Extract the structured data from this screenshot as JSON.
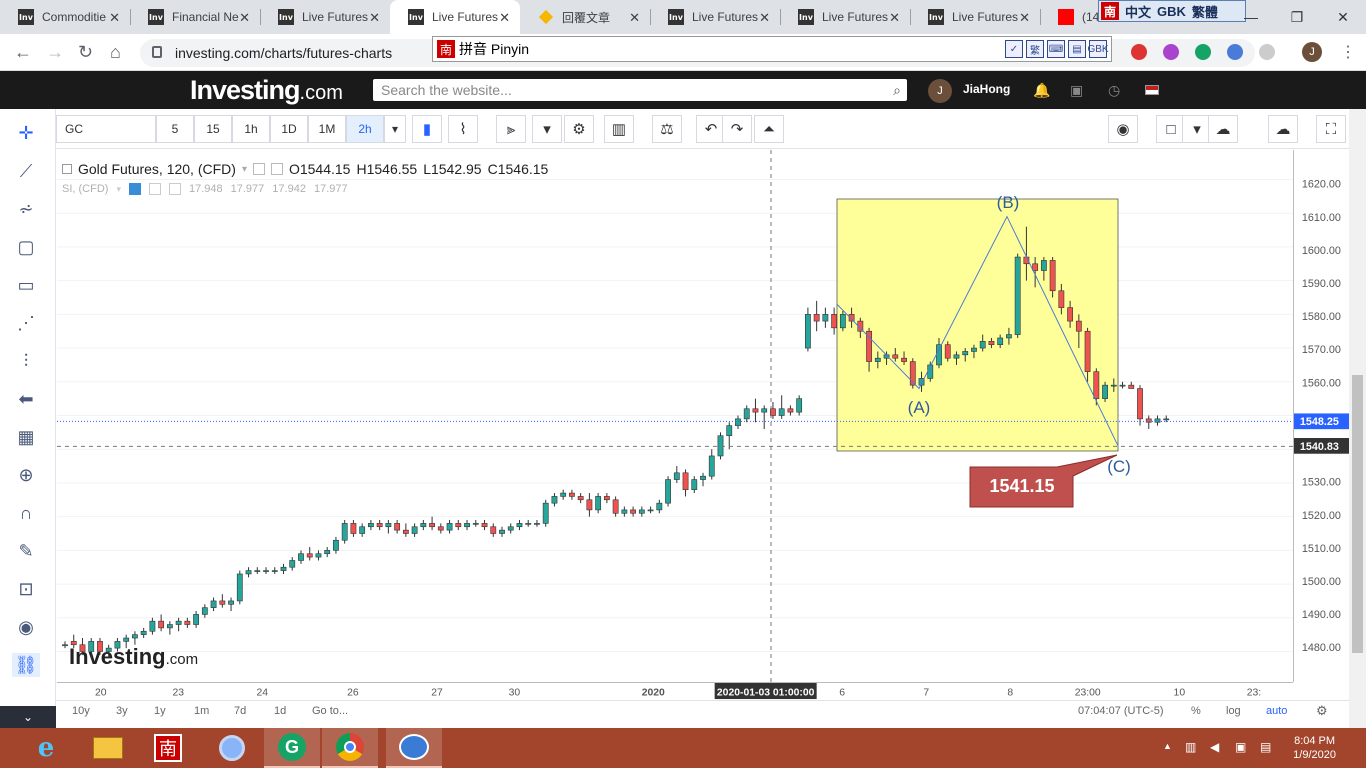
{
  "tabs": [
    {
      "title": "Commoditie",
      "icon": "Inv"
    },
    {
      "title": "Financial Ne",
      "icon": "Inv"
    },
    {
      "title": "Live Futures",
      "icon": "Inv"
    },
    {
      "title": "Live Futures",
      "icon": "Inv"
    },
    {
      "title": "回覆文章",
      "icon": "gem"
    },
    {
      "title": "Live Futures",
      "icon": "Inv"
    },
    {
      "title": "Live Futures",
      "icon": "Inv"
    },
    {
      "title": "Live Futures",
      "icon": "Inv"
    },
    {
      "title": "(14",
      "icon": "yt"
    }
  ],
  "active_tab": 3,
  "ime_bar": {
    "badge": "南",
    "lang": "中文",
    "charset": "GBK",
    "trad": "繁體"
  },
  "ime_popup": {
    "badge": "南",
    "label": "拼音 Pinyin",
    "buttons": [
      "✓",
      "繁",
      "⌨",
      "▤",
      "GBK"
    ]
  },
  "address": {
    "url": "investing.com/charts/futures-charts"
  },
  "profile_initial": "J",
  "site": {
    "logo_main": "Investing",
    "logo_suffix": ".com",
    "search_placeholder": "Search the website...",
    "user_initial": "J",
    "user_name": "JiaHong"
  },
  "toolbar": {
    "symbol": "GC",
    "intervals": [
      "5",
      "15",
      "1h",
      "1D",
      "1M",
      "2h"
    ],
    "active_interval": "2h"
  },
  "legend": {
    "title": "Gold Futures, 120, (CFD)",
    "o": "O1544.15",
    "h": "H1546.55",
    "l": "L1542.95",
    "c": "C1546.15",
    "compare": "SI, (CFD)",
    "compare_values": [
      "17.948",
      "17.977",
      "17.942",
      "17.977"
    ]
  },
  "annotations": {
    "a": "(A)",
    "b": "(B)",
    "c": "(C)",
    "callout": "1541.15",
    "watermark_main": "Investing",
    "watermark_suffix": ".com"
  },
  "price_axis": {
    "ticks": [
      "1620.00",
      "1610.00",
      "1600.00",
      "1590.00",
      "1580.00",
      "1570.00",
      "1560.00",
      "1530.00",
      "1520.00",
      "1510.00",
      "1500.00",
      "1490.00",
      "1480.00"
    ],
    "last_price": "1548.25",
    "crosshair_price": "1540.83"
  },
  "time_axis": {
    "labels": [
      "20",
      "23",
      "24",
      "26",
      "27",
      "30",
      "2020",
      "6",
      "7",
      "8",
      "23:00",
      "10",
      "23:"
    ],
    "crosshair_time": "2020-01-03 01:00:00"
  },
  "bottom": {
    "ranges": [
      "10y",
      "3y",
      "1y",
      "1m",
      "7d",
      "1d",
      "Go to..."
    ],
    "time": "07:04:07 (UTC-5)",
    "pct": "%",
    "log": "log",
    "auto": "auto"
  },
  "taskbar": {
    "time": "8:04 PM",
    "date": "1/9/2020"
  },
  "colors": {
    "up": "#26a69a",
    "down": "#ef5350",
    "accent": "#2962ff",
    "box": "#ffff99",
    "callout": "#c0504d"
  },
  "chart_data": {
    "type": "candlestick",
    "title": "Gold Futures, 120, (CFD)",
    "ylim": [
      1475,
      1625
    ],
    "candles": [
      [
        1482,
        1483,
        1481,
        1482
      ],
      [
        1483,
        1485,
        1481,
        1482
      ],
      [
        1482,
        1484,
        1479,
        1480
      ],
      [
        1480,
        1484,
        1478,
        1483
      ],
      [
        1483,
        1484,
        1479,
        1480
      ],
      [
        1480,
        1482,
        1478,
        1481
      ],
      [
        1481,
        1484,
        1480,
        1483
      ],
      [
        1483,
        1485,
        1481,
        1484
      ],
      [
        1484,
        1486,
        1482,
        1485
      ],
      [
        1485,
        1487,
        1484,
        1486
      ],
      [
        1486,
        1490,
        1485,
        1489
      ],
      [
        1489,
        1491,
        1486,
        1487
      ],
      [
        1487,
        1489,
        1485,
        1488
      ],
      [
        1488,
        1490,
        1486,
        1489
      ],
      [
        1489,
        1490,
        1487,
        1488
      ],
      [
        1488,
        1492,
        1487,
        1491
      ],
      [
        1491,
        1494,
        1490,
        1493
      ],
      [
        1493,
        1496,
        1492,
        1495
      ],
      [
        1495,
        1497,
        1493,
        1494
      ],
      [
        1494,
        1496,
        1492,
        1495
      ],
      [
        1495,
        1504,
        1494,
        1503
      ],
      [
        1503,
        1505,
        1502,
        1504
      ],
      [
        1504,
        1505,
        1503,
        1504
      ],
      [
        1504,
        1505,
        1503,
        1504
      ],
      [
        1504,
        1505,
        1503,
        1504
      ],
      [
        1504,
        1506,
        1503,
        1505
      ],
      [
        1505,
        1508,
        1504,
        1507
      ],
      [
        1507,
        1510,
        1506,
        1509
      ],
      [
        1509,
        1511,
        1507,
        1508
      ],
      [
        1508,
        1510,
        1507,
        1509
      ],
      [
        1509,
        1511,
        1508,
        1510
      ],
      [
        1510,
        1514,
        1509,
        1513
      ],
      [
        1513,
        1519,
        1512,
        1518
      ],
      [
        1518,
        1519,
        1514,
        1515
      ],
      [
        1515,
        1518,
        1514,
        1517
      ],
      [
        1517,
        1519,
        1516,
        1518
      ],
      [
        1518,
        1519,
        1516,
        1517
      ],
      [
        1517,
        1519,
        1515,
        1518
      ],
      [
        1518,
        1519,
        1515,
        1516
      ],
      [
        1516,
        1518,
        1514,
        1515
      ],
      [
        1515,
        1518,
        1514,
        1517
      ],
      [
        1517,
        1519,
        1516,
        1518
      ],
      [
        1518,
        1520,
        1516,
        1517
      ],
      [
        1517,
        1518,
        1515,
        1516
      ],
      [
        1516,
        1519,
        1515,
        1518
      ],
      [
        1518,
        1519,
        1516,
        1517
      ],
      [
        1517,
        1519,
        1516,
        1518
      ],
      [
        1518,
        1519,
        1517,
        1518
      ],
      [
        1518,
        1519,
        1516,
        1517
      ],
      [
        1517,
        1518,
        1514,
        1515
      ],
      [
        1515,
        1517,
        1514,
        1516
      ],
      [
        1516,
        1518,
        1515,
        1517
      ],
      [
        1517,
        1519,
        1516,
        1518
      ],
      [
        1518,
        1519,
        1517,
        1518
      ],
      [
        1518,
        1519,
        1517,
        1518
      ],
      [
        1518,
        1525,
        1517,
        1524
      ],
      [
        1524,
        1527,
        1523,
        1526
      ],
      [
        1526,
        1528,
        1525,
        1527
      ],
      [
        1527,
        1528,
        1525,
        1526
      ],
      [
        1526,
        1527,
        1524,
        1525
      ],
      [
        1525,
        1527,
        1520,
        1522
      ],
      [
        1522,
        1527,
        1521,
        1526
      ],
      [
        1526,
        1527,
        1524,
        1525
      ],
      [
        1525,
        1526,
        1520,
        1521
      ],
      [
        1521,
        1523,
        1520,
        1522
      ],
      [
        1522,
        1523,
        1520,
        1521
      ],
      [
        1521,
        1523,
        1520,
        1522
      ],
      [
        1522,
        1523,
        1521,
        1522
      ],
      [
        1522,
        1525,
        1521,
        1524
      ],
      [
        1524,
        1532,
        1523,
        1531
      ],
      [
        1531,
        1535,
        1530,
        1533
      ],
      [
        1533,
        1534,
        1526,
        1528
      ],
      [
        1528,
        1532,
        1527,
        1531
      ],
      [
        1531,
        1533,
        1529,
        1532
      ],
      [
        1532,
        1540,
        1531,
        1538
      ],
      [
        1538,
        1545,
        1537,
        1544
      ],
      [
        1544,
        1548,
        1540,
        1547
      ],
      [
        1547,
        1550,
        1546,
        1549
      ],
      [
        1549,
        1553,
        1548,
        1552
      ],
      [
        1552,
        1555,
        1548,
        1551
      ],
      [
        1551,
        1553,
        1546,
        1552
      ],
      [
        1552,
        1554,
        1549,
        1550
      ],
      [
        1550,
        1556,
        1549,
        1552
      ],
      [
        1552,
        1553,
        1550,
        1551
      ],
      [
        1551,
        1556,
        1550,
        1555
      ],
      [
        1570,
        1582,
        1569,
        1580
      ],
      [
        1580,
        1584,
        1575,
        1578
      ],
      [
        1578,
        1582,
        1576,
        1580
      ],
      [
        1580,
        1582,
        1574,
        1576
      ],
      [
        1576,
        1581,
        1575,
        1580
      ],
      [
        1580,
        1582,
        1576,
        1578
      ],
      [
        1578,
        1579,
        1573,
        1575
      ],
      [
        1575,
        1576,
        1563,
        1566
      ],
      [
        1566,
        1569,
        1564,
        1567
      ],
      [
        1567,
        1569,
        1565,
        1568
      ],
      [
        1568,
        1570,
        1566,
        1567
      ],
      [
        1567,
        1569,
        1565,
        1566
      ],
      [
        1566,
        1567,
        1558,
        1559
      ],
      [
        1559,
        1563,
        1557,
        1561
      ],
      [
        1561,
        1566,
        1560,
        1565
      ],
      [
        1565,
        1573,
        1564,
        1571
      ],
      [
        1571,
        1572,
        1566,
        1567
      ],
      [
        1567,
        1569,
        1565,
        1568
      ],
      [
        1568,
        1570,
        1566,
        1569
      ],
      [
        1569,
        1571,
        1567,
        1570
      ],
      [
        1570,
        1574,
        1569,
        1572
      ],
      [
        1572,
        1573,
        1570,
        1571
      ],
      [
        1571,
        1574,
        1570,
        1573
      ],
      [
        1573,
        1576,
        1571,
        1574
      ],
      [
        1574,
        1598,
        1573,
        1597
      ],
      [
        1597,
        1606,
        1590,
        1595
      ],
      [
        1595,
        1597,
        1588,
        1593
      ],
      [
        1593,
        1597,
        1590,
        1596
      ],
      [
        1596,
        1597,
        1585,
        1587
      ],
      [
        1587,
        1589,
        1580,
        1582
      ],
      [
        1582,
        1584,
        1576,
        1578
      ],
      [
        1578,
        1580,
        1570,
        1575
      ],
      [
        1575,
        1576,
        1560,
        1563
      ],
      [
        1563,
        1564,
        1553,
        1555
      ],
      [
        1555,
        1560,
        1554,
        1559
      ],
      [
        1559,
        1561,
        1557,
        1559
      ],
      [
        1559,
        1560,
        1558,
        1559
      ],
      [
        1559,
        1560,
        1558,
        1558
      ],
      [
        1558,
        1559,
        1547,
        1549
      ],
      [
        1549,
        1550,
        1546,
        1548
      ],
      [
        1548,
        1550,
        1547,
        1549
      ],
      [
        1549,
        1550,
        1548,
        1549
      ]
    ]
  }
}
